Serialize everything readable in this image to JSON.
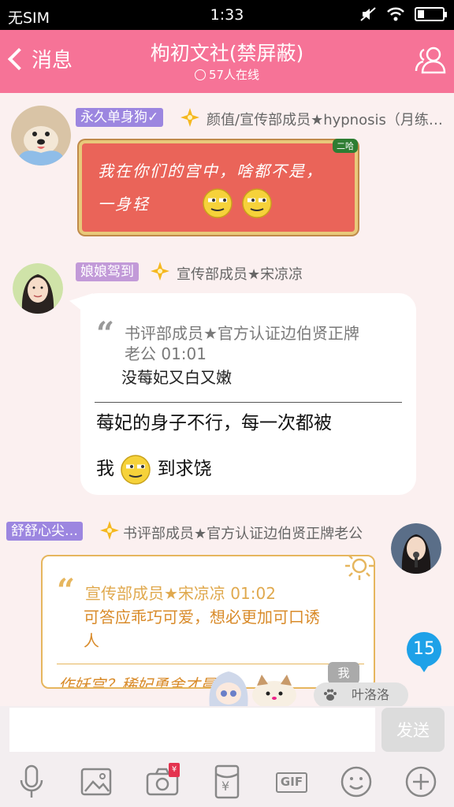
{
  "status_bar": {
    "carrier": "无SIM",
    "time": "1:33"
  },
  "header": {
    "back_label": "消息",
    "title": "枸初文社(禁屏蔽)",
    "online": "57人在线"
  },
  "messages": [
    {
      "badge": "永久单身狗✓",
      "badge_color": "#9c86e0",
      "role": "颜值/宣传部成员★hypnosis（月练…",
      "card_tag": "二哈",
      "card_text": "我在你们的宫中，啥都不是，一身轻"
    },
    {
      "badge": "娘娘驾到",
      "badge_color": "#c29ad8",
      "role": "宣传部成员★宋凉凉",
      "quote_author_1": "书评部成员★官方认证边伯贤正牌",
      "quote_author_2": "老公 01:01",
      "quote_text": "没莓妃又白又嫩",
      "reply_line_1": "莓妃的身子不行，每一次都被",
      "reply_line_2_a": "我",
      "reply_line_2_b": "到求饶"
    },
    {
      "badge": "舒舒心尖…",
      "badge_color": "#9c86e0",
      "role": "书评部成员★官方认证边伯贤正牌老公",
      "quote_author": "宣传部成员★宋凉凉 01:02",
      "quote_text_1": "可答应乖巧可爱，想必更加可口诱",
      "quote_text_2": "人",
      "partial_text": "作妖宫？稀妃勇舍才晨口"
    }
  ],
  "unread_count": "15",
  "mention": {
    "me": "我",
    "name": "叶洛洛"
  },
  "input": {
    "value": "",
    "send_label": "发送"
  },
  "toolbar": {
    "items": [
      "microphone-icon",
      "image-icon",
      "camera-icon",
      "red-packet-icon",
      "gif-icon",
      "emoji-icon",
      "plus-icon"
    ],
    "gif_label": "GIF",
    "red_packet_symbol": "¥",
    "camera_tag": "¥"
  },
  "colors": {
    "header": "#f67397",
    "accent_blue": "#1ea1e8",
    "card_red": "#ea6459",
    "gold": "#e6b65e"
  }
}
